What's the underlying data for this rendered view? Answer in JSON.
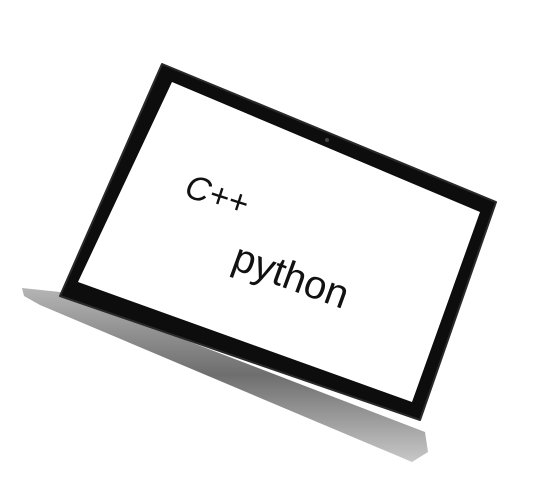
{
  "screen_text": {
    "line1": "C++",
    "line2": "python"
  },
  "colors": {
    "bezel": "#0d0d0d",
    "screen": "#ffffff",
    "base": "#8a8a8a",
    "text": "#111111"
  }
}
